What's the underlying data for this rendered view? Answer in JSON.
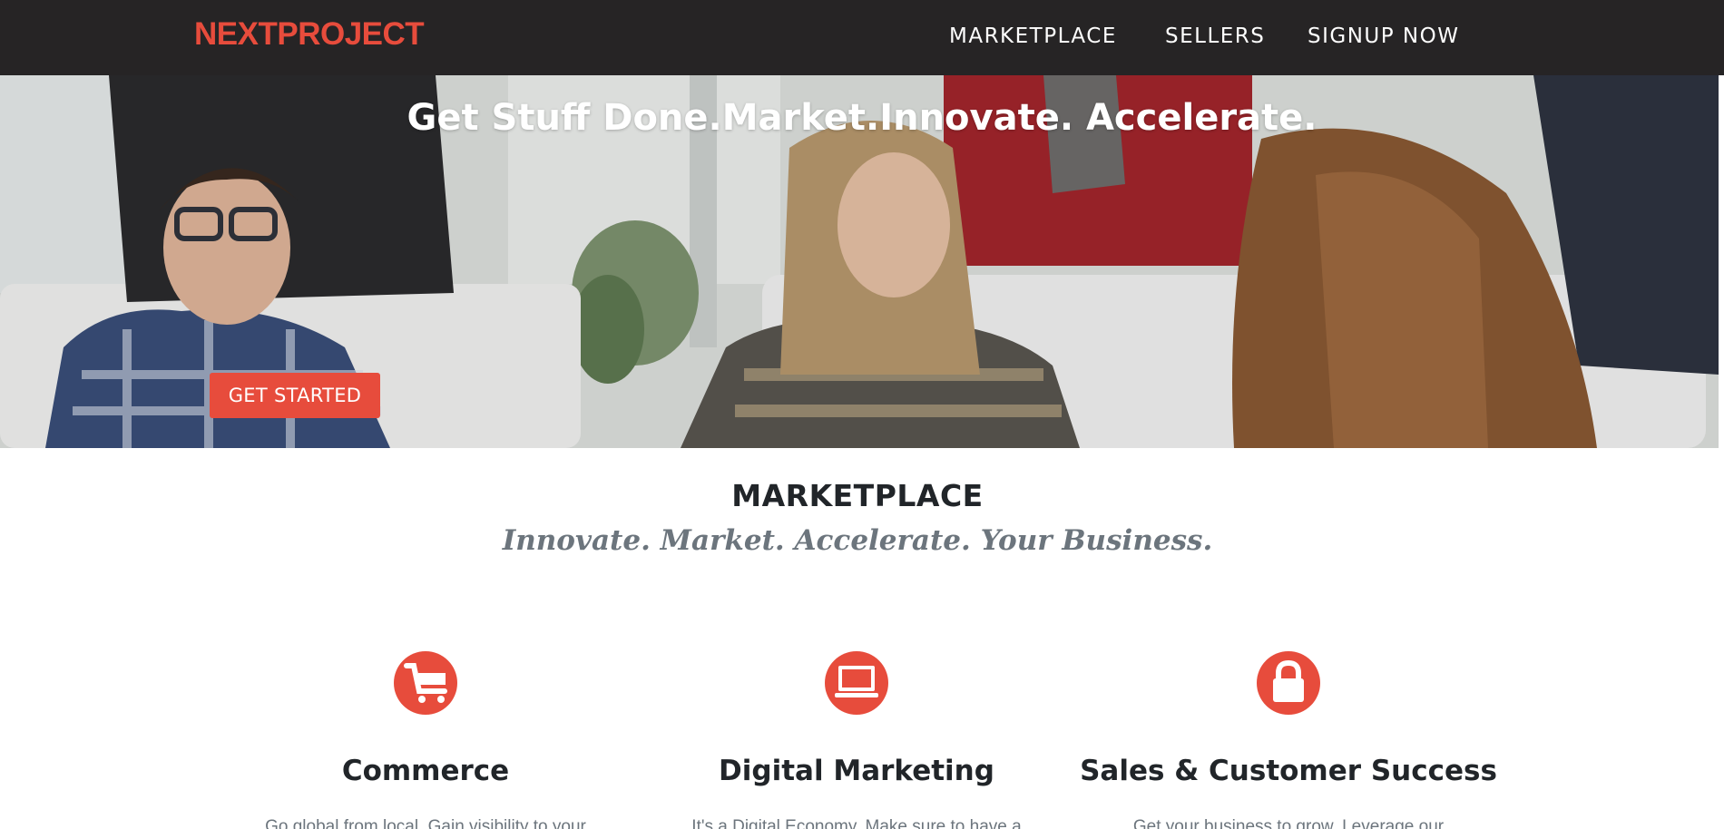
{
  "navbar": {
    "brand": "NEXTPROJECT",
    "links": [
      "MARKETPLACE",
      "SELLERS",
      "SIGNUP NOW"
    ]
  },
  "hero": {
    "title": "Get Stuff Done.Market.Innovate. Accelerate.",
    "cta_label": "GET STARTED"
  },
  "section": {
    "title": "MARKETPLACE",
    "subtitle": "Innovate. Market. Accelerate. Your Business."
  },
  "features": [
    {
      "icon": "shopping-cart-icon",
      "heading": "Commerce",
      "text": "Go global from local. Gain visibility to your"
    },
    {
      "icon": "laptop-icon",
      "heading": "Digital Marketing",
      "text": "It's a Digital Economy. Make sure to have a"
    },
    {
      "icon": "lock-icon",
      "heading": "Sales & Customer Success",
      "text": "Get your business to grow. Leverage our"
    }
  ],
  "colors": {
    "accent": "#e74c3c",
    "navbar_bg": "#262425",
    "heading": "#212529",
    "muted": "#6c757d"
  }
}
